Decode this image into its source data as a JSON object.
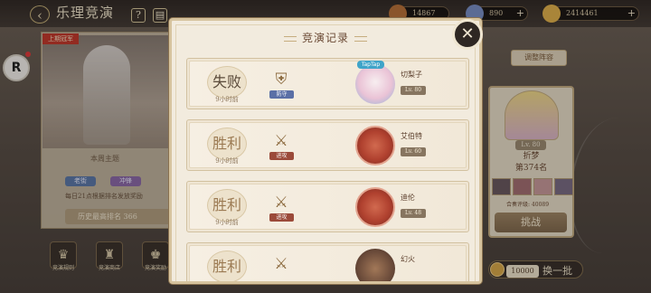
{
  "header": {
    "title": "乐理竞演",
    "help_icon": "?"
  },
  "resources": [
    {
      "name": "stamina",
      "value": "14867",
      "color": "#b8723a"
    },
    {
      "name": "gems",
      "value": "890",
      "color": "#7a8fc6"
    },
    {
      "name": "gold",
      "value": "2414461",
      "color": "#e2b24d"
    }
  ],
  "left_panel": {
    "rank_tag": "上期冠军",
    "weekly_label": "本周主题",
    "tags": [
      "老街",
      "冲锋"
    ],
    "reward_text": "每日21点根据排名发放奖励",
    "history_button": "历史最高排名 366"
  },
  "bottom_nav": [
    {
      "label": "竞演规则",
      "icon": "♛"
    },
    {
      "label": "竞演商店",
      "icon": "♜"
    },
    {
      "label": "竞演奖励",
      "icon": "♚"
    }
  ],
  "right_panel": {
    "adjust_button": "调整阵容",
    "opponent_level": "Lv. 80",
    "opponent_name": "折梦",
    "opponent_rank": "第374名",
    "power_text": "合奏评级: 40089",
    "challenge_button": "挑战",
    "refresh_cost": "10000",
    "refresh_label": "换一批"
  },
  "modal": {
    "title": "竞演记录",
    "close_icon": "✕",
    "records": [
      {
        "result": "失败",
        "time": "9小时前",
        "type": "防守",
        "type_color": "#5a6fa6",
        "opponent": "切梨子",
        "level": "Lv. 80",
        "avatar_color": "#eac3d6",
        "avatar_badge": "TapTap"
      },
      {
        "result": "胜利",
        "time": "9小时前",
        "type": "进攻",
        "type_color": "#9b4a3a",
        "opponent": "艾伯特",
        "level": "Lv. 60",
        "avatar_color": "#b0412f",
        "avatar_badge": ""
      },
      {
        "result": "胜利",
        "time": "9小时前",
        "type": "进攻",
        "type_color": "#9b4a3a",
        "opponent": "迪伦",
        "level": "Lv. 48",
        "avatar_color": "#b0412f",
        "avatar_badge": ""
      },
      {
        "result": "胜利",
        "time": "",
        "type": "",
        "type_color": "#9b4a3a",
        "opponent": "幻火",
        "level": "",
        "avatar_color": "#6b4b3a",
        "avatar_badge": ""
      }
    ]
  }
}
